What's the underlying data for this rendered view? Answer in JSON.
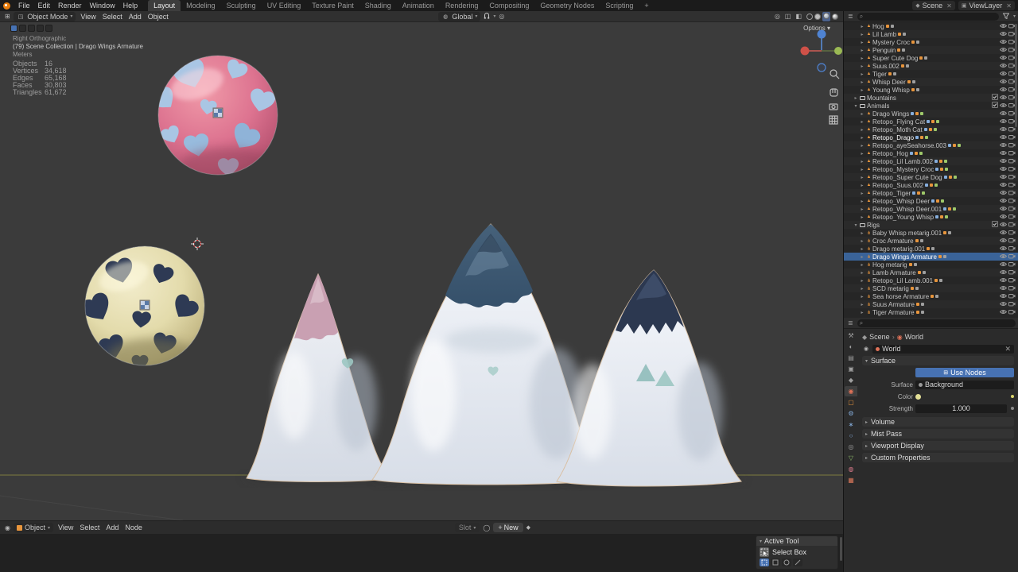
{
  "topbar": {
    "menus": [
      "File",
      "Edit",
      "Render",
      "Window",
      "Help"
    ],
    "workspaces": [
      "Layout",
      "Modeling",
      "Sculpting",
      "UV Editing",
      "Texture Paint",
      "Shading",
      "Animation",
      "Rendering",
      "Compositing",
      "Geometry Nodes",
      "Scripting",
      "+"
    ],
    "active_workspace": "Layout",
    "scene_label": "Scene",
    "viewlayer_label": "ViewLayer"
  },
  "viewport": {
    "header": {
      "mode": "Object Mode",
      "menus": [
        "View",
        "Select",
        "Add",
        "Object"
      ],
      "orientation": "Global"
    },
    "options_label": "Options",
    "overlay": {
      "view_label": "Right Orthographic",
      "context_label": "(79) Scene Collection | Drago Wings Armature",
      "units_label": "Meters",
      "stats": [
        {
          "label": "Objects",
          "value": "16"
        },
        {
          "label": "Vertices",
          "value": "34,618"
        },
        {
          "label": "Edges",
          "value": "65,168"
        },
        {
          "label": "Faces",
          "value": "30,803"
        },
        {
          "label": "Triangles",
          "value": "61,672"
        }
      ]
    },
    "colors": {
      "sphere_pink": "#dd7390",
      "sphere_cream": "#e3dbab",
      "heart_blue": "#a9c6e4",
      "heart_navy": "#2e3a54",
      "mountain_white": "#eef1f6",
      "cap_rose": "#c9a0b2",
      "cap_slate": "#3f5b76",
      "cap_navy": "#2c3850",
      "accent_teal": "#9cc6c2"
    }
  },
  "outliner": {
    "rows": [
      {
        "name": "Hog",
        "type": "object",
        "indent": 2,
        "badges": [
          "pose",
          "data"
        ]
      },
      {
        "name": "Lil Lamb",
        "type": "object",
        "indent": 2,
        "badges": [
          "pose",
          "data"
        ]
      },
      {
        "name": "Mystery Croc",
        "type": "object",
        "indent": 2,
        "badges": [
          "pose",
          "data"
        ]
      },
      {
        "name": "Penguin",
        "type": "object",
        "indent": 2,
        "badges": [
          "pose",
          "data"
        ]
      },
      {
        "name": "Super Cute Dog",
        "type": "object",
        "indent": 2,
        "badges": [
          "pose",
          "data"
        ]
      },
      {
        "name": "Suus.002",
        "type": "object",
        "indent": 2,
        "badges": [
          "pose",
          "data"
        ]
      },
      {
        "name": "Tiger",
        "type": "object",
        "indent": 2,
        "badges": [
          "pose",
          "data"
        ]
      },
      {
        "name": "Whisp Deer",
        "type": "object",
        "indent": 2,
        "badges": [
          "pose",
          "data"
        ]
      },
      {
        "name": "Young Whisp",
        "type": "object",
        "indent": 2,
        "badges": [
          "pose",
          "data"
        ]
      },
      {
        "name": "Mountains",
        "type": "collection",
        "indent": 1,
        "expanded": false,
        "checkbox": true,
        "badges": []
      },
      {
        "name": "Animals",
        "type": "collection",
        "indent": 1,
        "expanded": true,
        "checkbox": true,
        "badges": []
      },
      {
        "name": "Drago Wings",
        "type": "object",
        "indent": 2,
        "badges": [
          "mod",
          "pose",
          "mesh"
        ]
      },
      {
        "name": "Retopo_Flying Cat",
        "type": "object",
        "indent": 2,
        "badges": [
          "mod",
          "pose",
          "mesh"
        ]
      },
      {
        "name": "Retopo_Moth Cat",
        "type": "object",
        "indent": 2,
        "badges": [
          "mod",
          "pose",
          "mesh"
        ]
      },
      {
        "name": "Retopo_Drago",
        "type": "object",
        "indent": 2,
        "active": true,
        "badges": [
          "mod",
          "pose",
          "mesh"
        ]
      },
      {
        "name": "Retopo_ayeSeahorse.003",
        "type": "object",
        "indent": 2,
        "badges": [
          "mod",
          "pose",
          "mesh"
        ]
      },
      {
        "name": "Retopo_Hog",
        "type": "object",
        "indent": 2,
        "badges": [
          "mod",
          "pose",
          "mesh"
        ]
      },
      {
        "name": "Retopo_Lil Lamb.002",
        "type": "object",
        "indent": 2,
        "badges": [
          "mod",
          "pose",
          "mesh"
        ]
      },
      {
        "name": "Retopo_Mystery Croc",
        "type": "object",
        "indent": 2,
        "badges": [
          "mod",
          "pose",
          "mesh"
        ]
      },
      {
        "name": "Retopo_Super Cute Dog",
        "type": "object",
        "indent": 2,
        "badges": [
          "mod",
          "pose",
          "mesh"
        ]
      },
      {
        "name": "Retopo_Suus.002",
        "type": "object",
        "indent": 2,
        "badges": [
          "mod",
          "pose",
          "mesh"
        ]
      },
      {
        "name": "Retopo_Tiger",
        "type": "object",
        "indent": 2,
        "badges": [
          "mod",
          "pose",
          "mesh"
        ]
      },
      {
        "name": "Retopo_Whisp Deer",
        "type": "object",
        "indent": 2,
        "badges": [
          "mod",
          "pose",
          "mesh"
        ]
      },
      {
        "name": "Retopo_Whisp Deer.001",
        "type": "object",
        "indent": 2,
        "badges": [
          "mod",
          "pose",
          "mesh"
        ]
      },
      {
        "name": "Retopo_Young Whisp",
        "type": "object",
        "indent": 2,
        "badges": [
          "mod",
          "pose",
          "mesh"
        ]
      },
      {
        "name": "Rigs",
        "type": "collection",
        "indent": 1,
        "expanded": true,
        "checkbox": true,
        "badges": []
      },
      {
        "name": "Baby Whisp metarig.001",
        "type": "armature",
        "indent": 2,
        "badges": [
          "pose",
          "data"
        ]
      },
      {
        "name": "Croc Armature",
        "type": "armature",
        "indent": 2,
        "badges": [
          "pose",
          "data"
        ]
      },
      {
        "name": "Drago metarig.001",
        "type": "armature",
        "indent": 2,
        "badges": [
          "pose",
          "data"
        ]
      },
      {
        "name": "Drago Wings Armature",
        "type": "armature",
        "indent": 2,
        "selected": true,
        "badges": [
          "pose",
          "data"
        ]
      },
      {
        "name": "Hog metarig",
        "type": "armature",
        "indent": 2,
        "badges": [
          "pose",
          "data"
        ]
      },
      {
        "name": "Lamb Armature",
        "type": "armature",
        "indent": 2,
        "badges": [
          "pose",
          "data"
        ]
      },
      {
        "name": "Retopo_Lil Lamb.001",
        "type": "armature",
        "indent": 2,
        "badges": [
          "pose",
          "data"
        ]
      },
      {
        "name": "SCD metarig",
        "type": "armature",
        "indent": 2,
        "badges": [
          "pose",
          "data"
        ]
      },
      {
        "name": "Sea horse Armature",
        "type": "armature",
        "indent": 2,
        "badges": [
          "pose",
          "data"
        ]
      },
      {
        "name": "Suus Armature",
        "type": "armature",
        "indent": 2,
        "badges": [
          "pose",
          "data"
        ]
      },
      {
        "name": "Tiger Armature",
        "type": "armature",
        "indent": 2,
        "badges": [
          "pose",
          "data"
        ]
      }
    ]
  },
  "properties": {
    "tabs": [
      "tool",
      "render",
      "output",
      "view-layer",
      "scene",
      "world",
      "object",
      "modifiers",
      "particles",
      "physics",
      "constraints",
      "object-data",
      "material",
      "texture"
    ],
    "active_tab": "world",
    "breadcrumb": {
      "scene": "Scene",
      "world": "World"
    },
    "world_block": "World",
    "surface_panel": {
      "title": "Surface",
      "use_nodes": "Use Nodes",
      "surface_label": "Surface",
      "surface_value": "Background",
      "color_label": "Color",
      "strength_label": "Strength",
      "strength_value": "1.000"
    },
    "collapsed_sections": [
      "Volume",
      "Mist Pass",
      "Viewport Display",
      "Custom Properties"
    ]
  },
  "shader_editor": {
    "type_label": "Object",
    "menus": [
      "View",
      "Select",
      "Add",
      "Node"
    ],
    "slot_label": "Slot",
    "new_label": "New"
  },
  "active_tool": {
    "title": "Active Tool",
    "tool_name": "Select Box"
  }
}
